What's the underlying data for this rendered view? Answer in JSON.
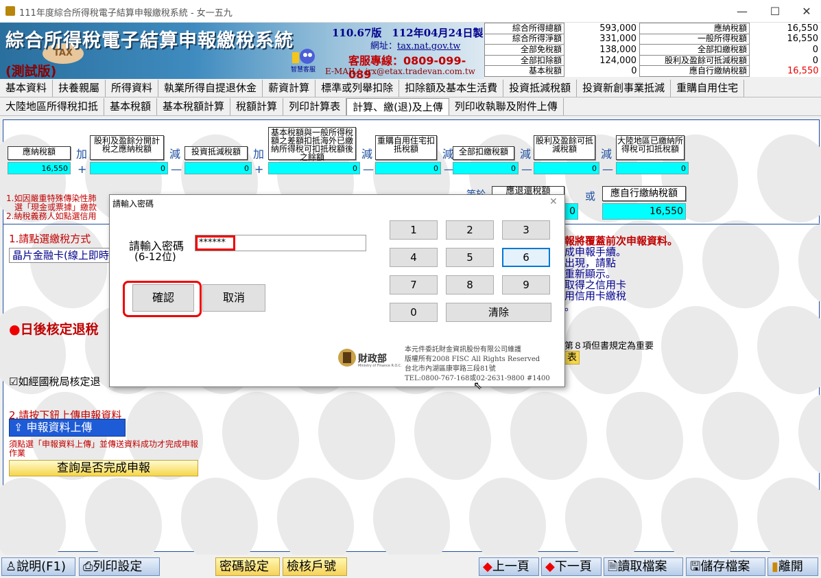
{
  "window": {
    "title": "111年度綜合所得稅電子結算申報繳稅系統 - 女一五九",
    "min": "—",
    "max": "☐",
    "close": "✕"
  },
  "banner": {
    "title": "綜合所得稅電子結算申報繳稅系統",
    "test": "(測試版)",
    "tax_disc": "TAX",
    "version": "110.67版　112年04月24日製",
    "url_label": "網址：",
    "url": "tax.nat.gov.tw",
    "service": "客服專線：0809-099-089",
    "email": "E-MAIL：irx@etax.tradevan.com.tw",
    "mascot_caption": "智慧客服"
  },
  "summary_left": [
    {
      "label": "綜合所得總額",
      "value": "593,000"
    },
    {
      "label": "綜合所得淨額",
      "value": "331,000"
    },
    {
      "label": "全部免稅額",
      "value": "138,000"
    },
    {
      "label": "全部扣除額",
      "value": "124,000"
    },
    {
      "label": "基本稅額",
      "value": "0"
    }
  ],
  "summary_right": [
    {
      "label": "應納稅額",
      "value": "16,550"
    },
    {
      "label": "一般所得稅額",
      "value": "16,550"
    },
    {
      "label": "全部扣繳稅額",
      "value": "0"
    },
    {
      "label": "股利及盈餘可抵減稅額",
      "value": "0"
    },
    {
      "label": "應自行繳納稅額",
      "value": "16,550"
    }
  ],
  "tabs_row1": [
    "基本資料",
    "扶養親屬",
    "所得資料",
    "執業所得自提退休金",
    "薪資計算",
    "標準或列舉扣除",
    "扣除額及基本生活費",
    "投資抵減稅額",
    "投資新創事業抵減",
    "重購自用住宅"
  ],
  "tabs_row2": [
    "大陸地區所得稅扣抵",
    "基本稅額",
    "基本稅額計算",
    "稅額計算",
    "列印計算表",
    "計算、繳(退)及上傳",
    "列印收執聯及附件上傳"
  ],
  "calc": {
    "items": [
      {
        "label": "應納稅額",
        "value": "16,550"
      },
      {
        "label": "股利及盈餘分開計稅之應納稅額",
        "value": "0"
      },
      {
        "label": "投資抵減稅額",
        "value": "0"
      },
      {
        "label": "基本稅額與一般所得稅額之差額扣抵海外已繳納所得稅可扣抵稅額後之餘額",
        "value": "0"
      },
      {
        "label": "重購自用住宅扣抵稅額",
        "value": "0"
      },
      {
        "label": "全部扣繳稅額",
        "value": "0"
      },
      {
        "label": "股利及盈餘可抵減稅額",
        "value": "0"
      },
      {
        "label": "大陸地區已繳納所得稅可扣抵稅額",
        "value": "0"
      }
    ],
    "ops_word": [
      "加",
      "減",
      "加",
      "減",
      "減",
      "減",
      "減"
    ],
    "ops_sym": [
      "+",
      "—",
      "+",
      "—",
      "—",
      "—",
      "—"
    ],
    "equals": "等於",
    "refund_label": "應退還稅額",
    "refund_value": "0",
    "or": "或",
    "pay_label": "應自行繳納稅額",
    "pay_value": "16,550"
  },
  "notes": {
    "n1": "1.如因嚴重特殊傳染性肺",
    "n1b": "選「現金或票據」繳款",
    "n2": "2.納稅義務人如點選信用"
  },
  "left": {
    "method_label": "1.請點選繳稅方式",
    "method_value": "晶片金融卡(線上即時",
    "refund_check": "日後核定退稅",
    "checkbox_label": "如經國稅局核定退",
    "upload_label": "2.請按下鈕上傳申報資料",
    "upload_btn": "申報資料上傳",
    "upload_note": "須點選「申報資料上傳」並傳送資料成功才完成申報作業",
    "query_btn": "查詢是否完成申報"
  },
  "right": {
    "warn": "報將覆蓋前次申報資料。",
    "l1": "成申報手續。",
    "l2": "出現，請點",
    "l3": "重新顯示。",
    "l4": "取得之信用卡",
    "l5": "用信用卡繳稅",
    "l6": "。",
    "rule": "第８項但書規定為重要",
    "rule_btn": "表"
  },
  "dialog": {
    "title": "請輸入密碼",
    "close": "✕",
    "prompt": "請輸入密碼",
    "hint": "(6-12位)",
    "password": "******",
    "ok": "確認",
    "cancel": "取消",
    "keys": [
      "1",
      "2",
      "3",
      "4",
      "5",
      "6",
      "7",
      "8",
      "9",
      "0"
    ],
    "clear": "清除",
    "logo": "財政部",
    "logo_sub": "Ministry of Finance R.O.C.",
    "footer": [
      "本元件委託財金資訊股份有限公司維護",
      "版權所有2008 FISC All Rights Reserved",
      "台北市內湖區康寧路三段81號",
      "TEL:0800-767-168或02-2631-9800 #1400"
    ]
  },
  "bottom": {
    "help": "說明(F1)",
    "print": "列印設定",
    "pwd": "密碼設定",
    "verify": "檢核戶號",
    "prev": "上一頁",
    "next": "下一頁",
    "read": "讀取檔案",
    "save": "儲存檔案",
    "exit": "離開"
  }
}
